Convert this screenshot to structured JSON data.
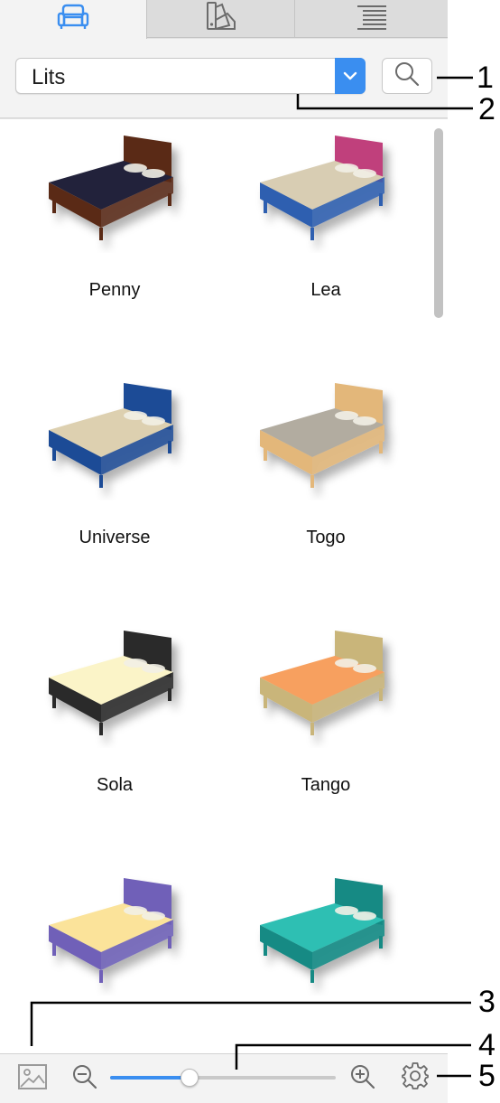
{
  "tabs": [
    {
      "icon": "furniture-catalog-icon",
      "selected": true
    },
    {
      "icon": "texture-swatch-icon",
      "selected": false
    },
    {
      "icon": "list-view-icon",
      "selected": false
    }
  ],
  "category_select": {
    "value": "Lits",
    "arrow_icon": "chevron-down-icon"
  },
  "search": {
    "icon": "search-icon"
  },
  "catalog": {
    "items": [
      {
        "label": "Penny",
        "colors": {
          "frame": "#5a2a16",
          "cover": "#24243a"
        }
      },
      {
        "label": "Lea",
        "colors": {
          "frame": "#2f5fb0",
          "cover": "#d8cdb3",
          "head": "#c0407c"
        }
      },
      {
        "label": "Universe",
        "colors": {
          "frame": "#1f4c96",
          "cover": "#ddd0b0"
        }
      },
      {
        "label": "Togo",
        "colors": {
          "frame": "#e3b77a",
          "cover": "#b2aca0"
        }
      },
      {
        "label": "Sola",
        "colors": {
          "frame": "#2a2a2a",
          "cover": "#fbf4c8"
        }
      },
      {
        "label": "Tango",
        "colors": {
          "frame": "#c9b57a",
          "cover": "#f7a05e"
        }
      },
      {
        "label": "",
        "colors": {
          "frame": "#6f61b8",
          "cover": "#fbe39a"
        }
      },
      {
        "label": "",
        "colors": {
          "frame": "#138a84",
          "cover": "#2dbfb3"
        }
      }
    ]
  },
  "bottom_bar": {
    "preview_icon": "image-preview-icon",
    "zoom_out_icon": "zoom-out-icon",
    "zoom_in_icon": "zoom-in-icon",
    "settings_icon": "gear-icon",
    "zoom_level": 0.35
  },
  "callouts": [
    "1",
    "2",
    "3",
    "4",
    "5"
  ],
  "colors": {
    "accent": "#3a8ef0"
  }
}
